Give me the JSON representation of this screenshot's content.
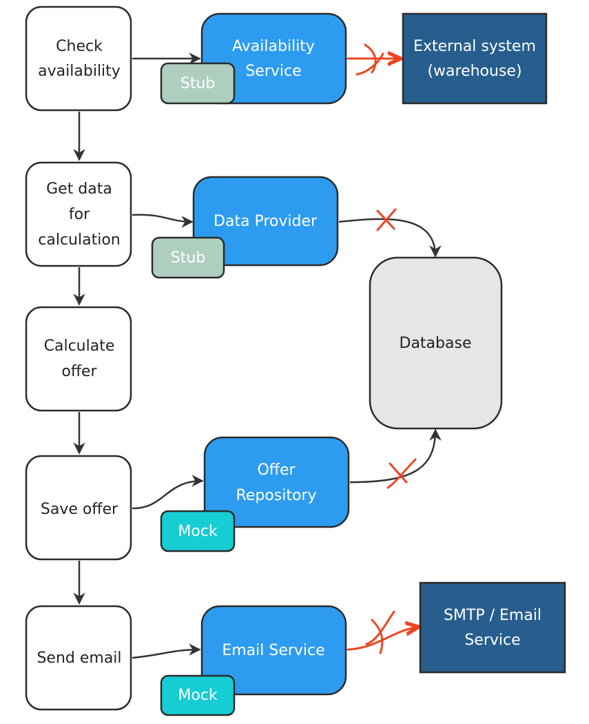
{
  "steps": [
    {
      "lines": [
        "Check",
        "availability"
      ]
    },
    {
      "lines": [
        "Get data",
        "for",
        "calculation"
      ]
    },
    {
      "lines": [
        "Calculate",
        "offer"
      ]
    },
    {
      "lines": [
        "Save offer"
      ]
    },
    {
      "lines": [
        "Send email"
      ]
    }
  ],
  "services": {
    "availability": {
      "lines": [
        "Availability",
        "Service"
      ],
      "badge": "Stub"
    },
    "data_provider": {
      "lines": [
        "Data Provider"
      ],
      "badge": "Stub"
    },
    "offer_repository": {
      "lines": [
        "Offer",
        "Repository"
      ],
      "badge": "Mock"
    },
    "email_service": {
      "lines": [
        "Email Service"
      ],
      "badge": "Mock"
    }
  },
  "external": {
    "warehouse": {
      "lines": [
        "External system",
        "(warehouse)"
      ]
    },
    "smtp": {
      "lines": [
        "SMTP / Email",
        "Service"
      ]
    },
    "database": {
      "lines": [
        "Database"
      ]
    }
  },
  "colors": {
    "service": "#2d9cf0",
    "external": "#285e8e",
    "stub": "#aecfc0",
    "mock": "#16cdd4",
    "database": "#e6e6e6",
    "blocked": "#ef4423"
  }
}
